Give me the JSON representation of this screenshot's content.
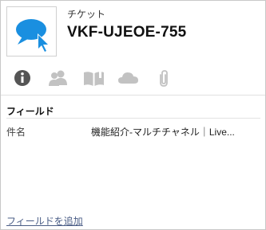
{
  "header": {
    "entity_type": "チケット",
    "entity_name": "VKF-UJEOE-755",
    "logo_icon": "chat-bubble-cursor-icon",
    "accent_color": "#1a8fe0"
  },
  "tabs": [
    {
      "icon": "info-icon",
      "active": true
    },
    {
      "icon": "people-icon",
      "active": false
    },
    {
      "icon": "book-icon",
      "active": false
    },
    {
      "icon": "cloud-icon",
      "active": false
    },
    {
      "icon": "paperclip-icon",
      "active": false
    }
  ],
  "section": {
    "title": "フィールド"
  },
  "fields": [
    {
      "label": "件名",
      "value": "機能紹介-マルチチャネル｜Live..."
    }
  ],
  "footer": {
    "add_field_label": "フィールドを追加"
  }
}
